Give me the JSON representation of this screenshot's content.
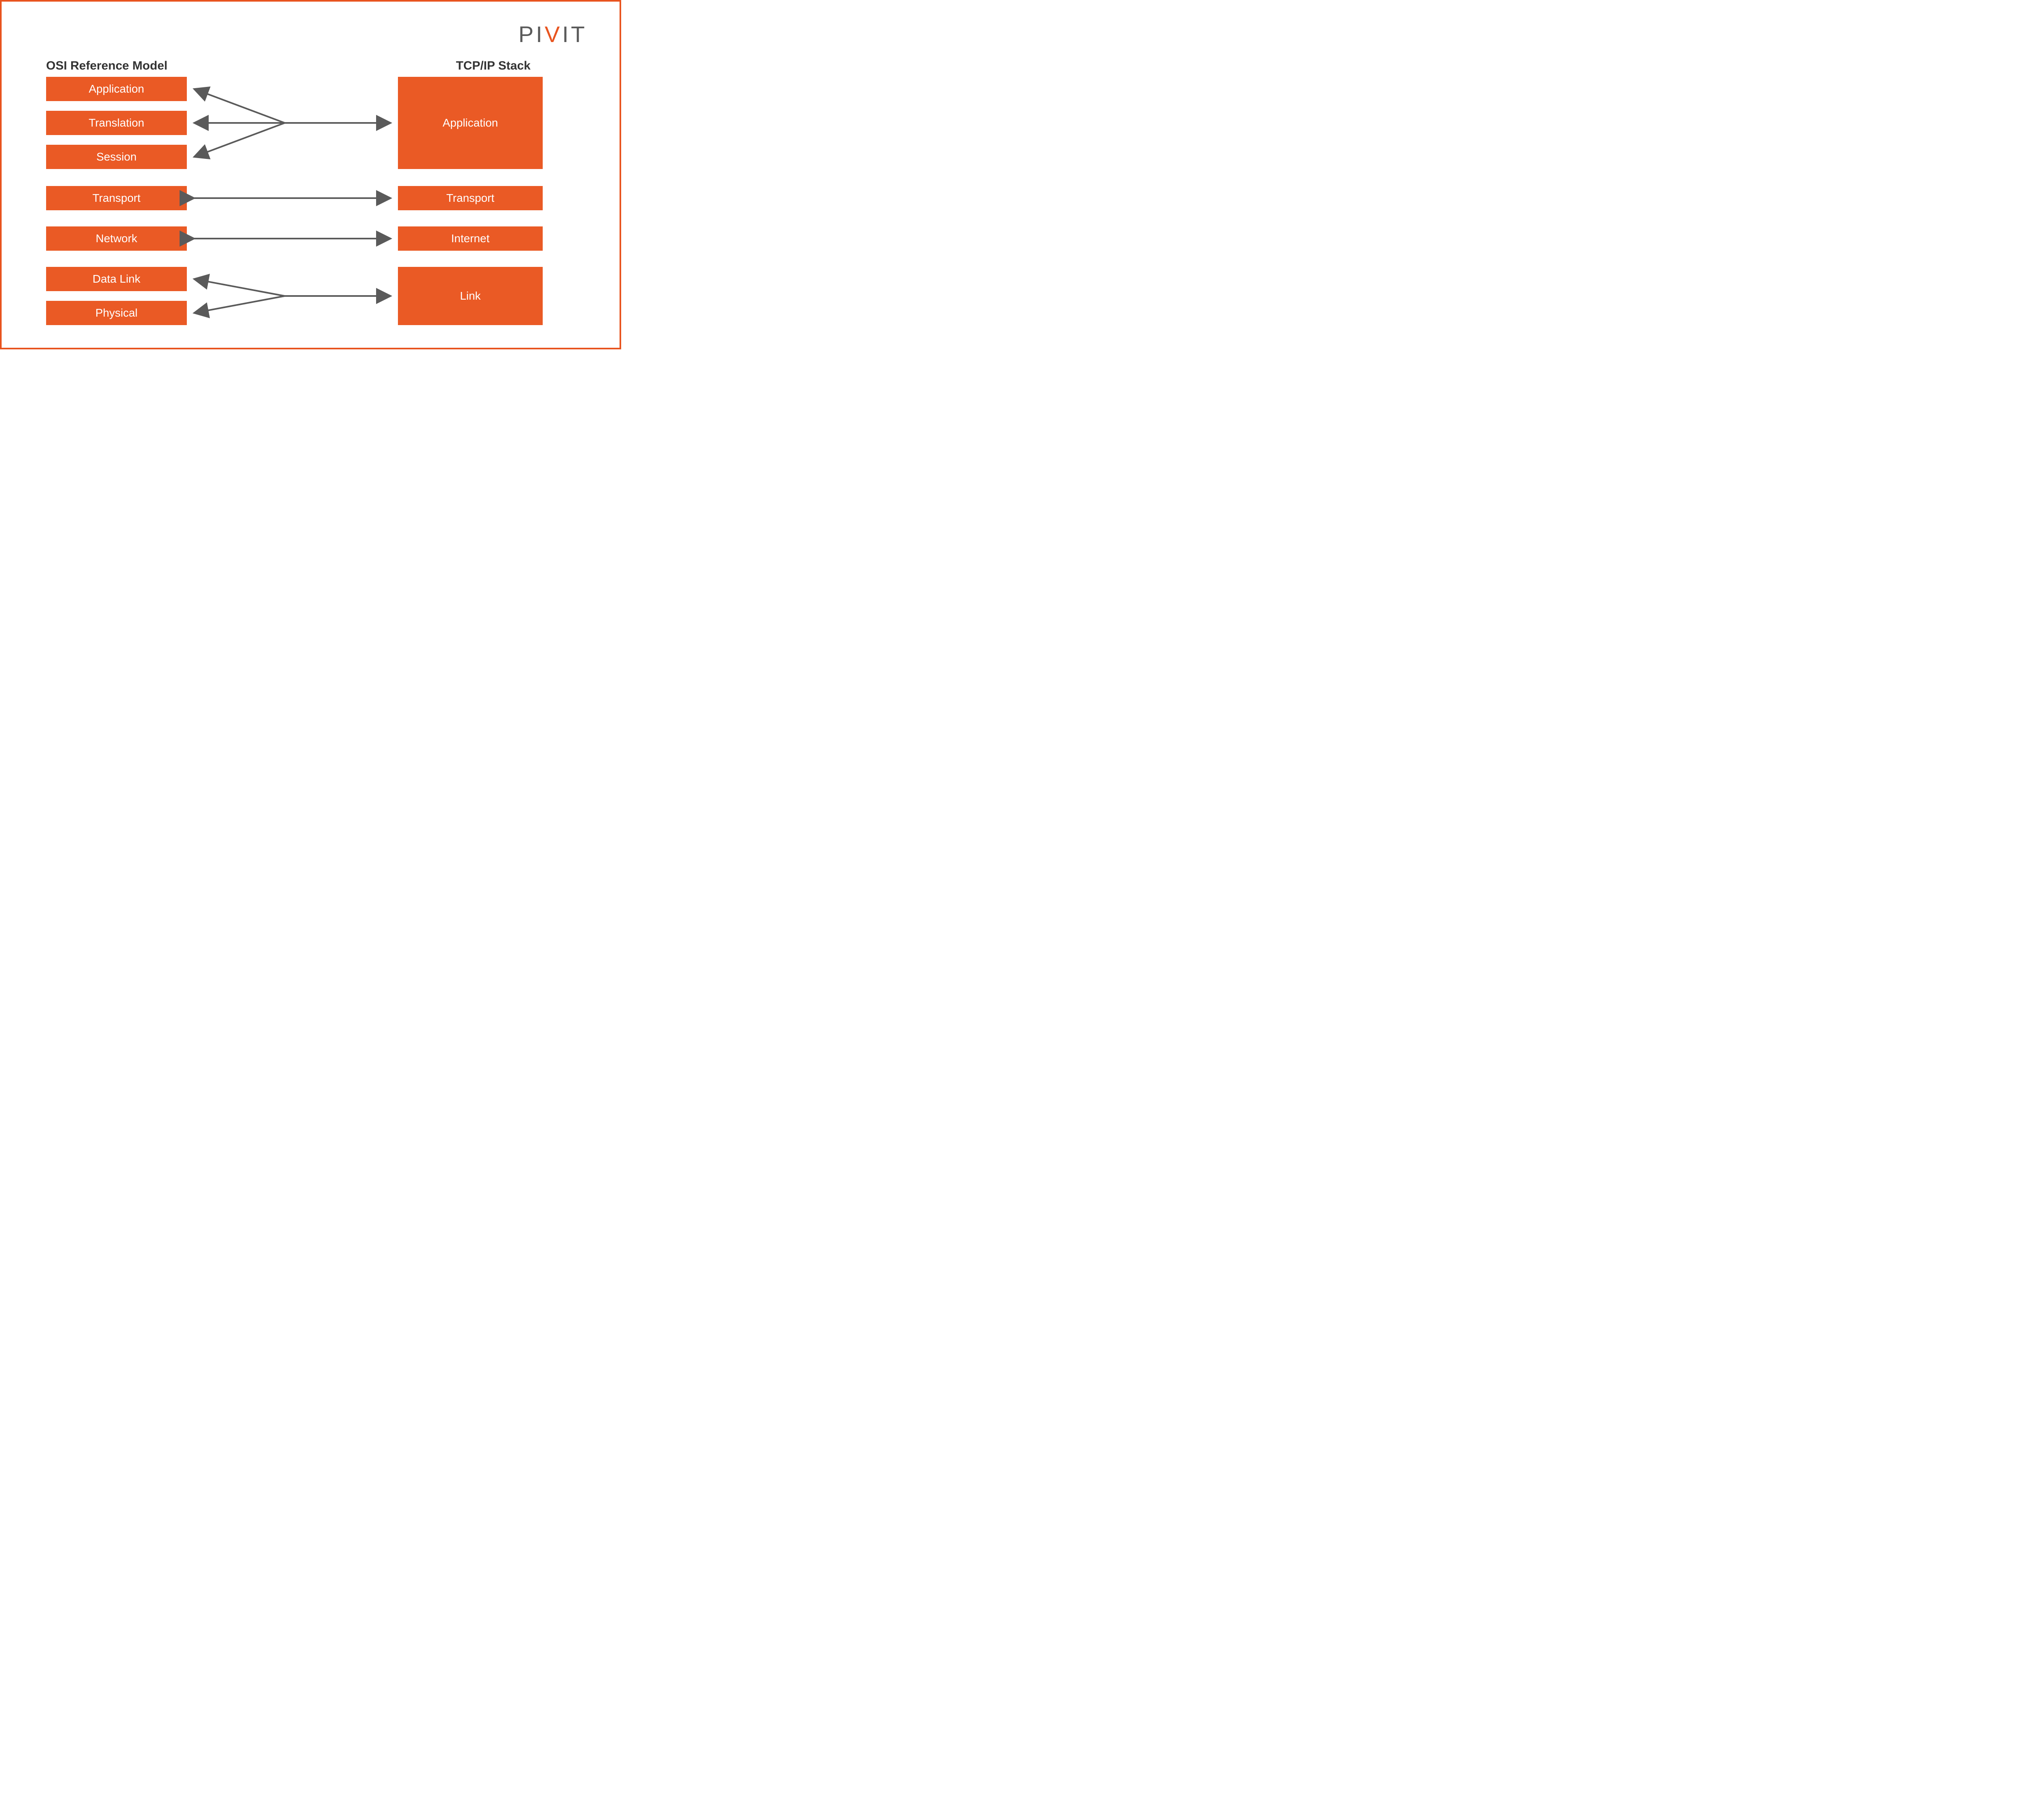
{
  "logo": {
    "p1": "PI",
    "v": "V",
    "p2": "IT"
  },
  "headings": {
    "osi": "OSI Reference Model",
    "tcp": "TCP/IP Stack"
  },
  "osi_layers": [
    "Application",
    "Translation",
    "Session",
    "Transport",
    "Network",
    "Data Link",
    "Physical"
  ],
  "tcp_layers": [
    "Application",
    "Transport",
    "Internet",
    "Link"
  ],
  "colors": {
    "brand": "#ea5a25",
    "arrow": "#5a5a5a",
    "text": "#333"
  }
}
